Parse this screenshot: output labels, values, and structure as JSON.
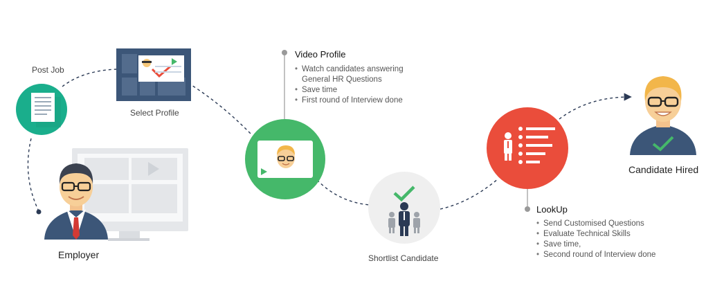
{
  "labels": {
    "post_job": "Post Job",
    "select_profile": "Select Profile",
    "employer": "Employer",
    "shortlist_candidate": "Shortlist Candidate",
    "candidate_hired": "Candidate Hired"
  },
  "video_profile": {
    "title": "Video Profile",
    "bullets": [
      "Watch candidates answering",
      "General HR Questions",
      "Save time",
      "First round of Interview done"
    ]
  },
  "lookup": {
    "title": "LookUp",
    "bullets": [
      "Send Customised Questions",
      "Evaluate Technical Skills",
      "Save time,",
      "Second round of Interview done"
    ]
  },
  "colors": {
    "teal": "#1aae8c",
    "green": "#45b86a",
    "red": "#ea4d3b",
    "navy": "#3c5678",
    "light_gray": "#efefef"
  },
  "icons": {
    "post_job": "document-icon",
    "select_profile": "profile-board-icon",
    "video_profile": "video-player-icon",
    "shortlist": "team-check-icon",
    "lookup": "checklist-icon",
    "employer": "employer-avatar-icon",
    "hired": "candidate-avatar-icon"
  }
}
